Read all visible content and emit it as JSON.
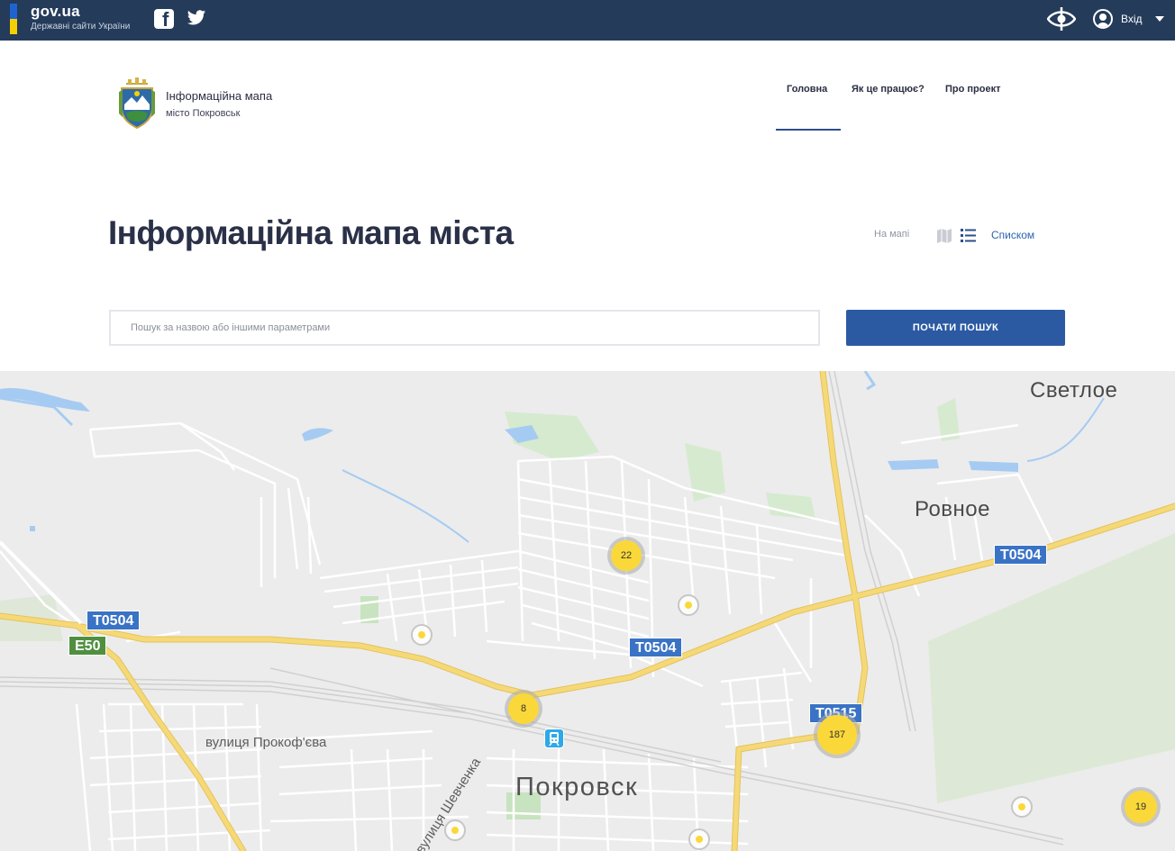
{
  "gov_bar": {
    "brand": "gov.ua",
    "subtitle": "Державні сайти України",
    "login_label": "Вхід"
  },
  "header": {
    "site_title": "Інформаційна мапа",
    "site_subtitle": "місто Покровськ",
    "nav": [
      "Головна",
      "Як це працює?",
      "Про проект"
    ],
    "active_nav": "Головна"
  },
  "main": {
    "page_title": "Інформаційна мапа міста",
    "view_on_map": "На мапі",
    "view_list": "Списком",
    "search_placeholder": "Пошук за назвою або іншими параметрами",
    "search_button": "ПОЧАТИ ПОШУК"
  },
  "map": {
    "places": [
      "Светлое",
      "Ровное",
      "Покровск"
    ],
    "streets": [
      "вулиця Прокоф'єва",
      "вулиця Шевченка"
    ],
    "road_signs": [
      "T0504",
      "E50",
      "T0504",
      "T0504",
      "T0515"
    ],
    "clusters": [
      "22",
      "8",
      "187",
      "19"
    ]
  },
  "colors": {
    "gov_bar": "#243b5a",
    "accent": "#2b5aa3",
    "marker": "#fbd83a",
    "road_major": "#f6d977",
    "water": "#a6cbf2",
    "park": "#cfe7c9"
  }
}
